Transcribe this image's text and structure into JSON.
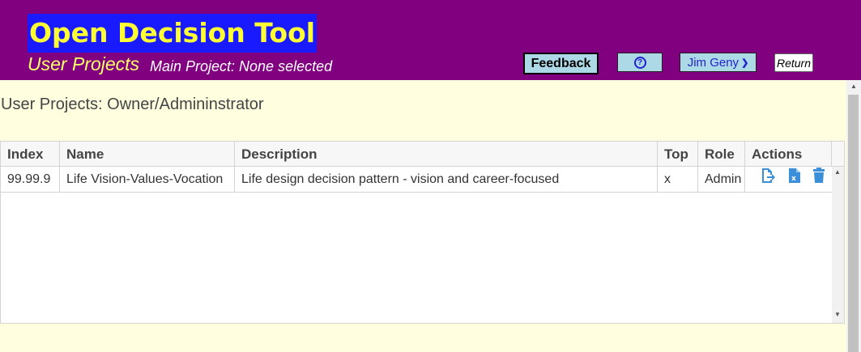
{
  "header": {
    "app_title": "Open Decision Tool",
    "subtitle": "User Projects",
    "main_project": "Main Project: None selected",
    "feedback_label": "Feedback",
    "help_icon": "question-circle-icon",
    "user_label": "Jim Geny",
    "return_label": "Return",
    "colors": {
      "header_bg": "#800080",
      "title_bg": "#1a1aff",
      "title_fg": "#ffff33",
      "button_bg": "#add8e6"
    }
  },
  "main": {
    "section_title": "User Projects: Owner/Admininstrator",
    "table": {
      "columns": [
        "Index",
        "Name",
        "Description",
        "Top",
        "Role",
        "Actions"
      ],
      "rows": [
        {
          "index": "99.99.9",
          "name": "Life Vision-Values-Vocation",
          "description": "Life design decision pattern - vision and career-focused",
          "top": "x",
          "role": "Admin",
          "actions": [
            "export-icon",
            "excel-file-icon",
            "trash-icon"
          ]
        }
      ]
    }
  }
}
